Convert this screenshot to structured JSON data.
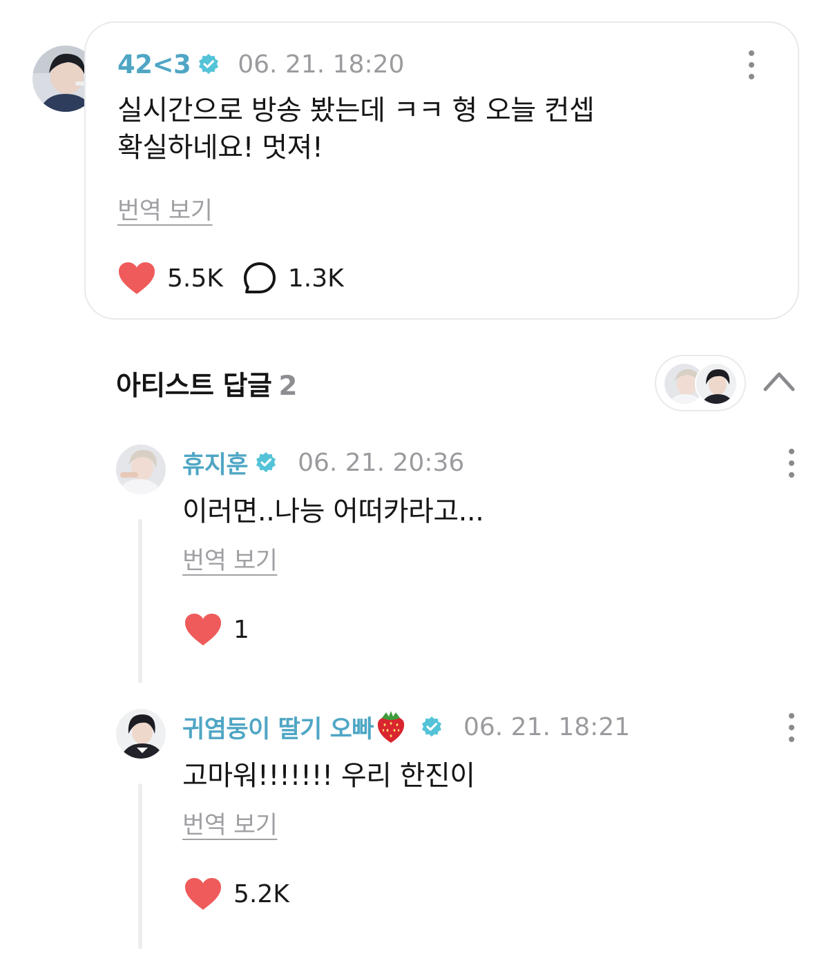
{
  "post": {
    "author": "42<3",
    "timestamp": "06. 21. 18:20",
    "text": "실시간으로 방송 봤는데 ㅋㅋ 형 오늘 컨셉\n확실하네요! 멋져!",
    "translate_label": "번역 보기",
    "likes": "5.5K",
    "comments": "1.3K"
  },
  "artist_replies": {
    "title": "아티스트 답글",
    "count": "2"
  },
  "replies": [
    {
      "author": "휴지훈",
      "timestamp": "06. 21. 20:36",
      "text": "이러면..나능 어떠카라고...",
      "translate_label": "번역 보기",
      "likes": "1"
    },
    {
      "author": "귀염둥이 딸기 오빠",
      "author_emoji_icon": "strawberry-icon",
      "timestamp": "06. 21. 18:21",
      "text": "고마워!!!!!!! 우리 한진이",
      "translate_label": "번역 보기",
      "likes": "5.2K"
    }
  ],
  "colors": {
    "author": "#4fa6c4",
    "verified": "#54c3d8",
    "heart": "#ef5b5b",
    "meta": "#9b9b9f",
    "border": "#e9e9ec"
  }
}
